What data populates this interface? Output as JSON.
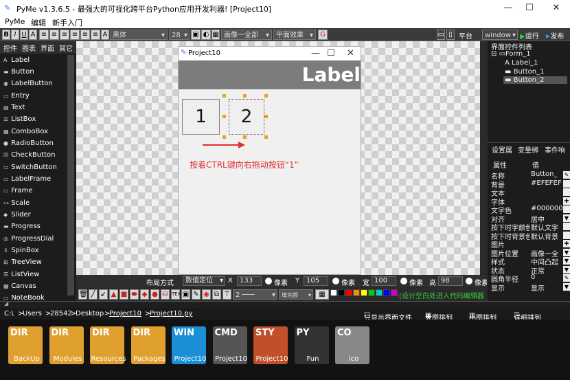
{
  "window": {
    "title": "PyMe v1.3.6.5 - 最强大的可视化跨平台Python应用开发利器!   [Project10]",
    "min": "—",
    "max": "☐",
    "close": "✕"
  },
  "menu": [
    "PyMe",
    "编辑",
    "新手入门"
  ],
  "toolbar": {
    "format_buttons": [
      "B",
      "I",
      "U",
      "A"
    ],
    "font": "黑体",
    "font_size": "28",
    "image_mode": "画像一全部",
    "effect": "平面效果",
    "platform_label": "平台",
    "platform": "window",
    "run": "运行",
    "publish": "发布"
  },
  "left_tabs": [
    "控件",
    "图表",
    "界面",
    "其它"
  ],
  "controls": [
    "Label",
    "Button",
    "LabelButton",
    "Entry",
    "Text",
    "ListBox",
    "ComboBox",
    "RadioButton",
    "CheckButton",
    "SwitchButton",
    "LabelFrame",
    "Frame",
    "Scale",
    "Slider",
    "Progress",
    "ProgressDial",
    "SpinBox",
    "TreeView",
    "ListView",
    "Canvas",
    "NoteBook"
  ],
  "form": {
    "title": "Project10",
    "label_text": "Label",
    "button1": "1",
    "button2": "2",
    "hint": "按着CTRL键向右拖动按钮“1”"
  },
  "layout_bar": {
    "title": "布局方式",
    "mode": "数值定位",
    "x_label": "X",
    "x": "133",
    "unit": "像素",
    "y_label": "Y",
    "y": "105",
    "w_label": "宽",
    "w": "100",
    "h_label": "高",
    "h": "98",
    "tip": "(设计空白处进入代码编辑器"
  },
  "right_panel": {
    "title": "界面控件列表",
    "tree": [
      "Form_1",
      "Label_1",
      "Button_1",
      "Button_2"
    ],
    "tabs": [
      "设置属",
      "变量绑",
      "事件响"
    ],
    "header": [
      "属性",
      "值"
    ],
    "props": [
      {
        "name": "名称",
        "value": "Button_"
      },
      {
        "name": "背景",
        "value": "#EFEFEF"
      },
      {
        "name": "文本",
        "value": ""
      },
      {
        "name": "字体",
        "value": ""
      },
      {
        "name": "文字色",
        "value": "#000000"
      },
      {
        "name": "对齐",
        "value": "居中"
      },
      {
        "name": "按下时字颜色",
        "value": "默认文字"
      },
      {
        "name": "按下时背景色",
        "value": "默认背景"
      },
      {
        "name": "图片",
        "value": ""
      },
      {
        "name": "图片位置",
        "value": "画像一全"
      },
      {
        "name": "样式",
        "value": "中间凸起"
      },
      {
        "name": "状态",
        "value": "正常"
      },
      {
        "name": "圆角半径",
        "value": "0"
      },
      {
        "name": "显示",
        "value": "显示"
      }
    ]
  },
  "path_bar": {
    "path": [
      "C:\\",
      "Users",
      "28542",
      "Desktop",
      "Project10",
      "Project10.py"
    ],
    "only_ui": "只显示界面文件",
    "big": "大图排列",
    "small": "小图排列",
    "detail": "详细排列"
  },
  "files": [
    {
      "tag": "DIR",
      "name": "BackUp",
      "color": "#e0a030"
    },
    {
      "tag": "DIR",
      "name": "Modules",
      "color": "#e0a030"
    },
    {
      "tag": "DIR",
      "name": "Resources",
      "color": "#e0a030"
    },
    {
      "tag": "DIR",
      "name": "Packages",
      "color": "#e0a030"
    },
    {
      "tag": "WIN",
      "name": "Project10",
      "color": "#1a8fd6"
    },
    {
      "tag": "CMD",
      "name": "Project10",
      "color": "#555555"
    },
    {
      "tag": "STY",
      "name": "Project10",
      "color": "#c0502a"
    },
    {
      "tag": "PY",
      "name": "Fun",
      "color": "#333333"
    },
    {
      "tag": "CO",
      "name": "ico",
      "color": "#888888"
    }
  ]
}
